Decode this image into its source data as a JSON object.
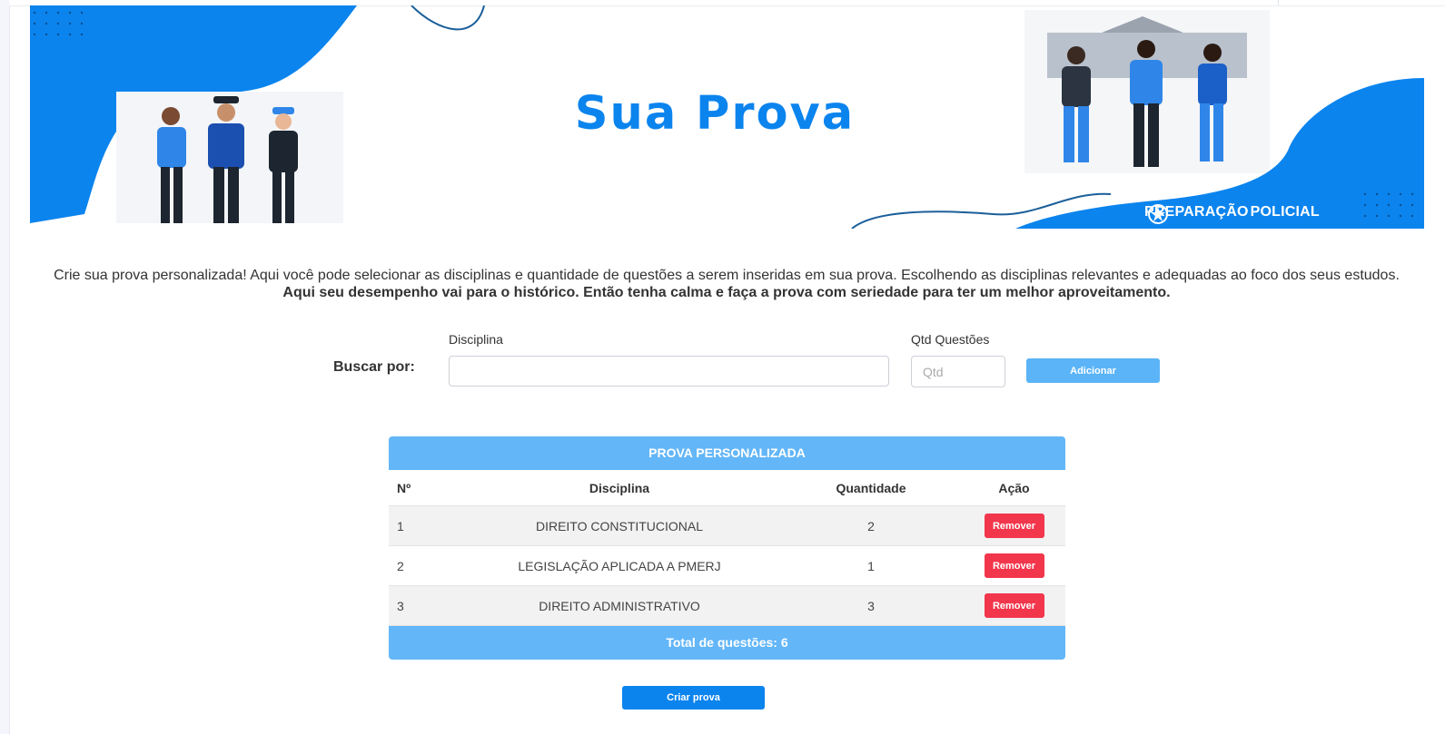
{
  "banner": {
    "title": "Sua Prova",
    "brand_left": "PREPARAÇÃO",
    "brand_right": "POLICIAL",
    "colors": {
      "primary": "#0b84ee",
      "light": "#63b6f8",
      "danger": "#f2364c"
    }
  },
  "intro": {
    "text": "Crie sua prova personalizada! Aqui você pode selecionar as disciplinas e quantidade de questões a serem inseridas em sua prova. Escolhendo as disciplinas relevantes e adequadas ao foco dos seus estudos.",
    "bold": "Aqui seu desempenho vai para o histórico. Então tenha calma e faça a prova com seriedade para ter um melhor aproveitamento."
  },
  "search": {
    "label": "Buscar por:",
    "discipline_label": "Disciplina",
    "discipline_value": "",
    "qty_label": "Qtd Questões",
    "qty_placeholder": "Qtd",
    "add_button": "Adicionar"
  },
  "table": {
    "title": "PROVA PERSONALIZADA",
    "headers": {
      "num": "Nº",
      "discipline": "Disciplina",
      "quantity": "Quantidade",
      "action": "Ação"
    },
    "rows": [
      {
        "num": "1",
        "discipline": "DIREITO CONSTITUCIONAL",
        "quantity": "2",
        "action": "Remover"
      },
      {
        "num": "2",
        "discipline": "LEGISLAÇÃO APLICADA A PMERJ",
        "quantity": "1",
        "action": "Remover"
      },
      {
        "num": "3",
        "discipline": "DIREITO ADMINISTRATIVO",
        "quantity": "3",
        "action": "Remover"
      }
    ],
    "total": "Total de questões: 6"
  },
  "create_button": "Criar prova"
}
